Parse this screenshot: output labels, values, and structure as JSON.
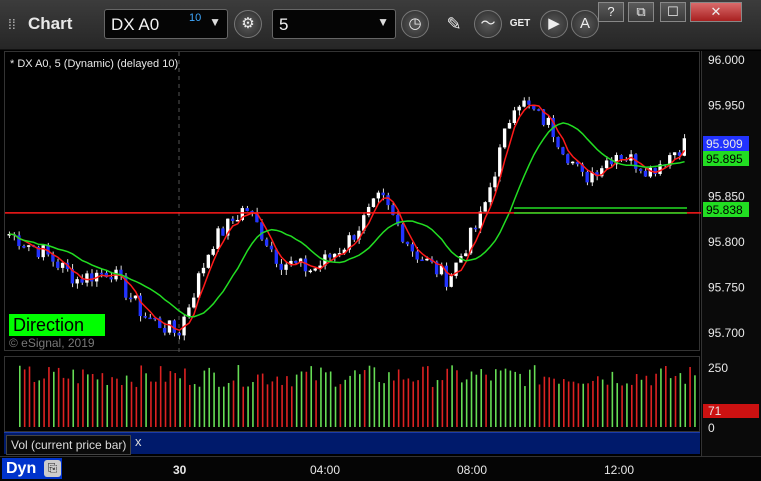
{
  "toolbar": {
    "title": "Chart",
    "symbol": "DX A0",
    "symbol_badge": "10",
    "interval": "5",
    "get_label": "GET"
  },
  "window_buttons": {
    "help": "?",
    "restore": "⧉",
    "maximize": "☐",
    "close": "✕"
  },
  "price_pane": {
    "legend": "* DX A0, 5 (Dynamic) (delayed 10)",
    "direction_label": "Direction",
    "copyright": "© eSignal, 2019"
  },
  "price_axis": {
    "ticks": [
      "96.000",
      "95.950",
      "95.900",
      "95.850",
      "95.800",
      "95.750",
      "95.700"
    ],
    "tick_values": [
      96.0,
      95.95,
      95.9,
      95.85,
      95.8,
      95.75,
      95.7
    ],
    "last_price": "95.909",
    "green_tag_1": "95.895",
    "green_tag_2": "95.838"
  },
  "volume_pane": {
    "label": "Vol (current price bar)",
    "close_icon": "x",
    "ticks": [
      "250",
      "0"
    ],
    "current": "71"
  },
  "time_axis": {
    "labels": [
      "30",
      "04:00",
      "08:00",
      "12:00"
    ]
  },
  "status": {
    "mode": "Dyn"
  },
  "colors": {
    "bull": "#ffffff",
    "bear": "#2233ff",
    "red_line": "#ff1a1a",
    "green_line": "#22dd22",
    "direction_bg": "#00ff00",
    "last_price_bg": "#2233ff",
    "vol_current_bg": "#cc1111"
  },
  "chart_data": {
    "type": "line",
    "title": "",
    "ylim": [
      95.68,
      96.01
    ],
    "x": [
      "30",
      "04:00",
      "08:00",
      "12:00"
    ],
    "series": [
      {
        "name": "DX A0, 5",
        "values": [
          95.81,
          95.79,
          95.76,
          95.77,
          95.72,
          95.7,
          95.8,
          95.84,
          95.78,
          95.77,
          95.8,
          95.85,
          95.79,
          95.76,
          95.83,
          95.96,
          95.93,
          95.87,
          95.9,
          95.88,
          95.91
        ]
      }
    ]
  }
}
